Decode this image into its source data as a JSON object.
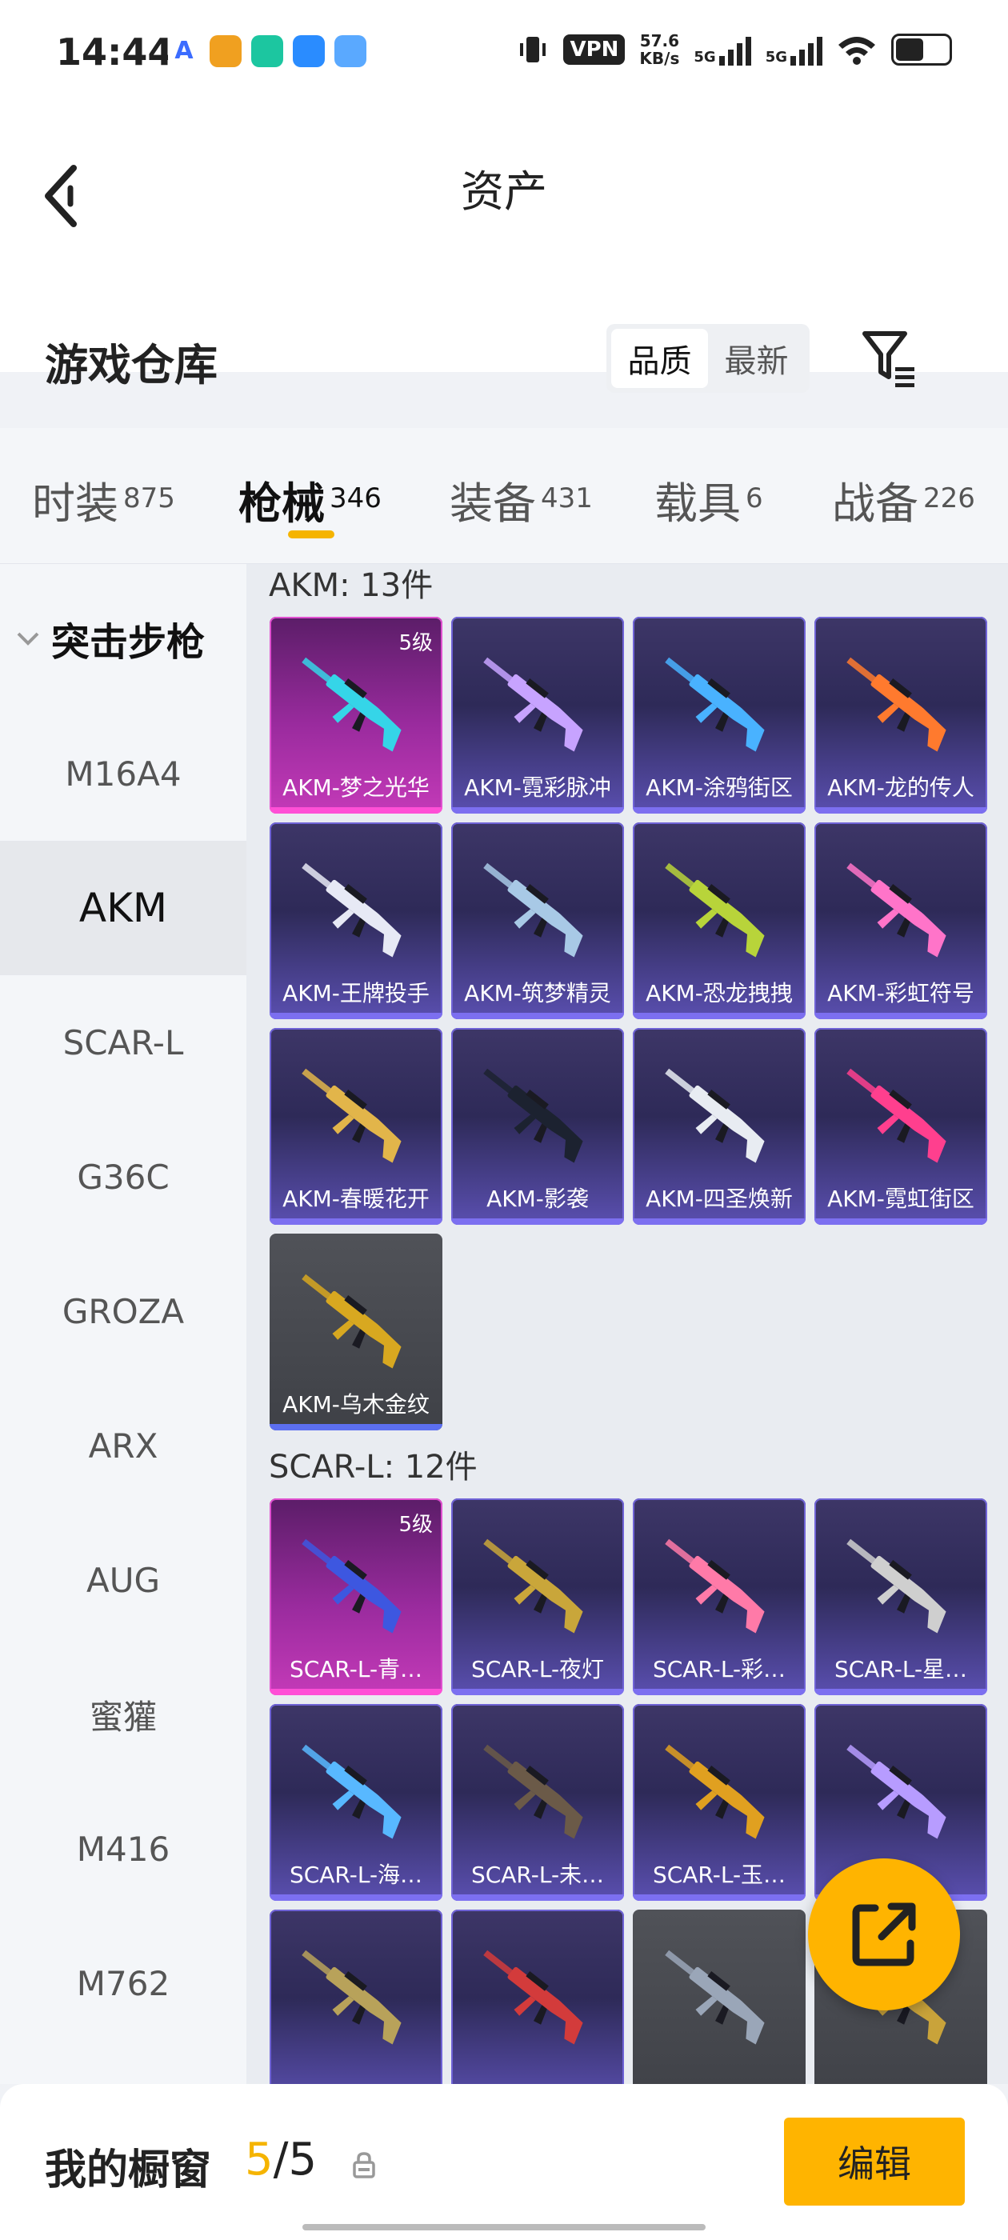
{
  "status_bar": {
    "time": "14:44",
    "vpn": "VPN",
    "speed_value": "57.6",
    "speed_unit": "KB/s",
    "net1": "5G",
    "net2": "5G"
  },
  "header": {
    "title": "资产"
  },
  "warehouse": {
    "title": "游戏仓库",
    "sort_options": [
      "品质",
      "最新"
    ],
    "selected_sort": "品质"
  },
  "tabs": [
    {
      "label": "时装",
      "count": "875"
    },
    {
      "label": "枪械",
      "count": "346",
      "active": true
    },
    {
      "label": "装备",
      "count": "431"
    },
    {
      "label": "载具",
      "count": "6"
    },
    {
      "label": "战备",
      "count": "226"
    }
  ],
  "sidebar": {
    "category": "突击步枪",
    "items": [
      "M16A4",
      "AKM",
      "SCAR-L",
      "G36C",
      "GROZA",
      "ARX",
      "AUG",
      "蜜獾",
      "M416",
      "M762"
    ],
    "selected": "AKM"
  },
  "groups": [
    {
      "title": "AKM: 13件",
      "items": [
        {
          "name": "AKM-梦之光华",
          "level": "5级",
          "tier": "gold",
          "gun": "#35d5e8"
        },
        {
          "name": "AKM-霓彩脉冲",
          "tier": "purple",
          "gun": "#c7a3ff"
        },
        {
          "name": "AKM-涂鸦街区",
          "tier": "purple",
          "gun": "#49b2ff"
        },
        {
          "name": "AKM-龙的传人",
          "tier": "purple",
          "gun": "#ff7a2e"
        },
        {
          "name": "AKM-王牌投手",
          "tier": "purple",
          "gun": "#e7e9f5"
        },
        {
          "name": "AKM-筑梦精灵",
          "tier": "purple",
          "gun": "#a8c9e6"
        },
        {
          "name": "AKM-恐龙拽拽",
          "tier": "purple",
          "gun": "#b8d43a"
        },
        {
          "name": "AKM-彩虹符号",
          "tier": "purple",
          "gun": "#ff74c9"
        },
        {
          "name": "AKM-春暖花开",
          "tier": "purple",
          "gun": "#e2b54a"
        },
        {
          "name": "AKM-影袭",
          "tier": "purple",
          "gun": "#1c2230"
        },
        {
          "name": "AKM-四圣焕新",
          "tier": "purple",
          "gun": "#e8ecf2"
        },
        {
          "name": "AKM-霓虹街区",
          "tier": "purple",
          "gun": "#ff3f8e"
        },
        {
          "name": "AKM-乌木金纹",
          "tier": "grey",
          "gun": "#d8a820"
        }
      ]
    },
    {
      "title": "SCAR-L: 12件",
      "items": [
        {
          "name": "SCAR-L-青…",
          "level": "5级",
          "tier": "gold",
          "gun": "#3d57e0"
        },
        {
          "name": "SCAR-L-夜灯",
          "tier": "purple",
          "gun": "#c9a63a"
        },
        {
          "name": "SCAR-L-彩…",
          "tier": "purple",
          "gun": "#ff7aa8"
        },
        {
          "name": "SCAR-L-星…",
          "tier": "purple",
          "gun": "#cfcfcf"
        },
        {
          "name": "SCAR-L-海…",
          "tier": "purple",
          "gun": "#58b8ff"
        },
        {
          "name": "SCAR-L-未…",
          "tier": "purple",
          "gun": "#6b5a48"
        },
        {
          "name": "SCAR-L-玉…",
          "tier": "purple",
          "gun": "#e0a020"
        },
        {
          "name": "",
          "tier": "purple",
          "gun": "#b79cff"
        },
        {
          "name": "",
          "tier": "purple",
          "gun": "#b8a25a"
        },
        {
          "name": "",
          "tier": "purple",
          "gun": "#d33b3b"
        },
        {
          "name": "",
          "tier": "grey",
          "gun": "#9aa6b8"
        },
        {
          "name": "",
          "tier": "grey",
          "gun": "#c9a33a"
        }
      ]
    }
  ],
  "showcase": {
    "label": "我的橱窗",
    "count": "5",
    "total": "/5",
    "edit_label": "编辑"
  },
  "colors": {
    "accent": "#ffb400",
    "gold_tier": "#c43ab8",
    "purple_tier": "#5a4fb0"
  }
}
